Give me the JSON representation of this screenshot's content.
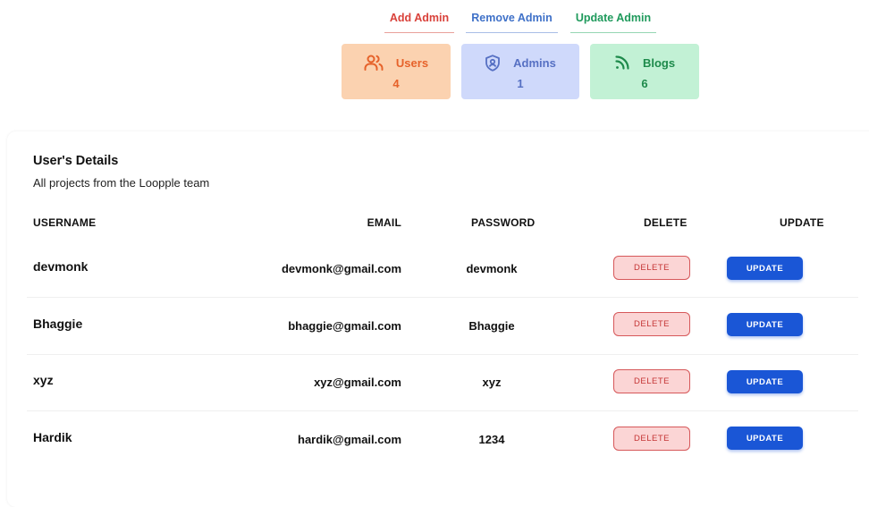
{
  "admin_links": {
    "add": "Add Admin",
    "remove": "Remove Admin",
    "update": "Update Admin"
  },
  "stats": {
    "users": {
      "label": "Users",
      "count": "4",
      "icon": "users-icon",
      "color": "#e6622a"
    },
    "admins": {
      "label": "Admins",
      "count": "1",
      "icon": "shield-icon",
      "color": "#5670c3"
    },
    "blogs": {
      "label": "Blogs",
      "count": "6",
      "icon": "rss-icon",
      "color": "#1d8a4b"
    }
  },
  "panel": {
    "title": "User's Details",
    "subtitle": "All projects from the Loopple team"
  },
  "table": {
    "headers": [
      "USERNAME",
      "EMAIL",
      "PASSWORD",
      "DELETE",
      "UPDATE"
    ],
    "rows": [
      {
        "username": "devmonk",
        "email": "devmonk@gmail.com",
        "password": "devmonk"
      },
      {
        "username": "Bhaggie",
        "email": "bhaggie@gmail.com",
        "password": "Bhaggie"
      },
      {
        "username": "xyz",
        "email": "xyz@gmail.com",
        "password": "xyz"
      },
      {
        "username": "Hardik",
        "email": "hardik@gmail.com",
        "password": "1234"
      }
    ],
    "delete_label": "DELETE",
    "update_label": "UPDATE"
  },
  "colors": {
    "delete_bg": "#fbd5d5",
    "delete_border": "#d6585a",
    "update_bg": "#1a56d6"
  }
}
